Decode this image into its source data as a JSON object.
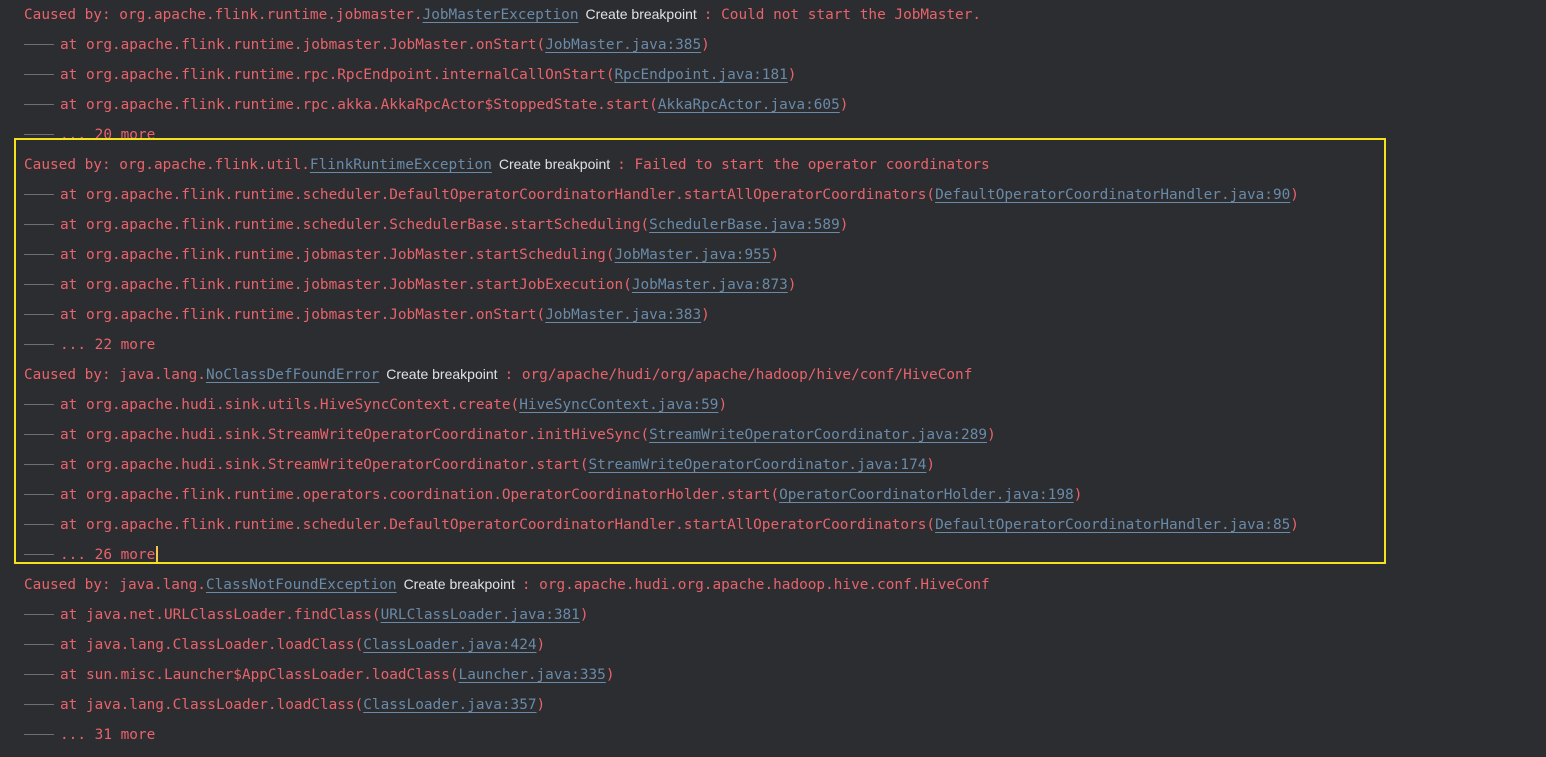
{
  "breakpoint_label": "Create breakpoint",
  "trace": [
    {
      "type": "cause",
      "prefix": "Caused by: org.apache.flink.runtime.jobmaster.",
      "cls": "JobMasterException",
      "msg": ": Could not start the JobMaster."
    },
    {
      "type": "frame",
      "method": "at org.apache.flink.runtime.jobmaster.JobMaster.onStart(",
      "loc": "JobMaster.java:385",
      "suffix": ")"
    },
    {
      "type": "frame",
      "method": "at org.apache.flink.runtime.rpc.RpcEndpoint.internalCallOnStart(",
      "loc": "RpcEndpoint.java:181",
      "suffix": ")"
    },
    {
      "type": "frame",
      "method": "at org.apache.flink.runtime.rpc.akka.AkkaRpcActor$StoppedState.start(",
      "loc": "AkkaRpcActor.java:605",
      "suffix": ")"
    },
    {
      "type": "more",
      "text": "... 20 more"
    },
    {
      "type": "cause",
      "prefix": "Caused by: org.apache.flink.util.",
      "cls": "FlinkRuntimeException",
      "msg": ": Failed to start the operator coordinators"
    },
    {
      "type": "frame",
      "method": "at org.apache.flink.runtime.scheduler.DefaultOperatorCoordinatorHandler.startAllOperatorCoordinators(",
      "loc": "DefaultOperatorCoordinatorHandler.java:90",
      "suffix": ")"
    },
    {
      "type": "frame",
      "method": "at org.apache.flink.runtime.scheduler.SchedulerBase.startScheduling(",
      "loc": "SchedulerBase.java:589",
      "suffix": ")"
    },
    {
      "type": "frame",
      "method": "at org.apache.flink.runtime.jobmaster.JobMaster.startScheduling(",
      "loc": "JobMaster.java:955",
      "suffix": ")"
    },
    {
      "type": "frame",
      "method": "at org.apache.flink.runtime.jobmaster.JobMaster.startJobExecution(",
      "loc": "JobMaster.java:873",
      "suffix": ")"
    },
    {
      "type": "frame",
      "method": "at org.apache.flink.runtime.jobmaster.JobMaster.onStart(",
      "loc": "JobMaster.java:383",
      "suffix": ")"
    },
    {
      "type": "more",
      "text": "... 22 more"
    },
    {
      "type": "cause",
      "prefix": "Caused by: java.lang.",
      "cls": "NoClassDefFoundError",
      "msg": ": org/apache/hudi/org/apache/hadoop/hive/conf/HiveConf"
    },
    {
      "type": "frame",
      "method": "at org.apache.hudi.sink.utils.HiveSyncContext.create(",
      "loc": "HiveSyncContext.java:59",
      "suffix": ")"
    },
    {
      "type": "frame",
      "method": "at org.apache.hudi.sink.StreamWriteOperatorCoordinator.initHiveSync(",
      "loc": "StreamWriteOperatorCoordinator.java:289",
      "suffix": ")"
    },
    {
      "type": "frame",
      "method": "at org.apache.hudi.sink.StreamWriteOperatorCoordinator.start(",
      "loc": "StreamWriteOperatorCoordinator.java:174",
      "suffix": ")"
    },
    {
      "type": "frame",
      "method": "at org.apache.flink.runtime.operators.coordination.OperatorCoordinatorHolder.start(",
      "loc": "OperatorCoordinatorHolder.java:198",
      "suffix": ")"
    },
    {
      "type": "frame",
      "method": "at org.apache.flink.runtime.scheduler.DefaultOperatorCoordinatorHandler.startAllOperatorCoordinators(",
      "loc": "DefaultOperatorCoordinatorHandler.java:85",
      "suffix": ")"
    },
    {
      "type": "more",
      "text": "... 26 more",
      "caret": true
    },
    {
      "type": "cause",
      "prefix": "Caused by: java.lang.",
      "cls": "ClassNotFoundException",
      "msg": ": org.apache.hudi.org.apache.hadoop.hive.conf.HiveConf"
    },
    {
      "type": "frame",
      "method": "at java.net.URLClassLoader.findClass(",
      "loc": "URLClassLoader.java:381",
      "suffix": ")"
    },
    {
      "type": "frame",
      "method": "at java.lang.ClassLoader.loadClass(",
      "loc": "ClassLoader.java:424",
      "suffix": ")"
    },
    {
      "type": "frame",
      "method": "at sun.misc.Launcher$AppClassLoader.loadClass(",
      "loc": "Launcher.java:335",
      "suffix": ")"
    },
    {
      "type": "frame",
      "method": "at java.lang.ClassLoader.loadClass(",
      "loc": "ClassLoader.java:357",
      "suffix": ")"
    },
    {
      "type": "more",
      "text": "... 31 more"
    }
  ]
}
